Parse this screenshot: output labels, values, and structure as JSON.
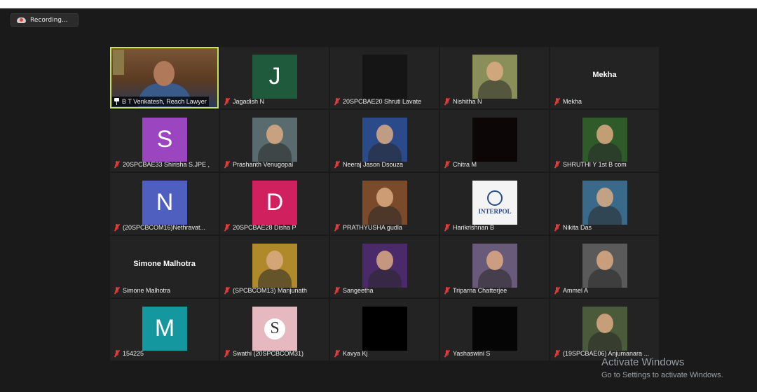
{
  "recording": {
    "label": "Recording..."
  },
  "participants": [
    {
      "name": "B T Venkatesh, Reach Lawyer",
      "type": "video",
      "pinned": true,
      "active": true,
      "bg": "#6b4a2e"
    },
    {
      "name": "Jagadish N",
      "type": "letter",
      "letter": "J",
      "bg": "#1f5a3d"
    },
    {
      "name": "20SPCBAE20 Shruti Lavate",
      "type": "photo",
      "bg": "#151515"
    },
    {
      "name": "Nishitha N",
      "type": "photo",
      "bg": "#8a8f5a"
    },
    {
      "name": "Mekha",
      "type": "text",
      "display": "Mekha"
    },
    {
      "name": "20SPCBAE33 Shirisha S.JPE ,",
      "type": "letter",
      "letter": "S",
      "bg": "#9b45c0"
    },
    {
      "name": "Prashanth Venugopal",
      "type": "photo",
      "bg": "#5a6b70"
    },
    {
      "name": "Neeraj Jason  Dsouza",
      "type": "photo",
      "bg": "#2a4a8a"
    },
    {
      "name": "Chitra M",
      "type": "photo",
      "bg": "#0d0606"
    },
    {
      "name": "SHRUTHI Y 1st B com",
      "type": "photo",
      "bg": "#2f5a2a"
    },
    {
      "name": "(20SPCBCOM16)Nethravat...",
      "type": "letter",
      "letter": "N",
      "bg": "#4f5fc0"
    },
    {
      "name": "20SPCBAE28 Disha P",
      "type": "letter",
      "letter": "D",
      "bg": "#d0215e"
    },
    {
      "name": "PRATHYUSHA gudla",
      "type": "photo",
      "bg": "#7a4a2a"
    },
    {
      "name": "Harikrishnan B",
      "type": "photo",
      "bg": "#f4f4f4"
    },
    {
      "name": "Nikita Das",
      "type": "photo",
      "bg": "#3a6a8a"
    },
    {
      "name": "Simone Malhotra",
      "type": "text",
      "display": "Simone Malhotra"
    },
    {
      "name": "(SPCBCOM13) Manjunath",
      "type": "photo",
      "bg": "#b08a2a"
    },
    {
      "name": "Sangeetha",
      "type": "photo",
      "bg": "#4a2a6a"
    },
    {
      "name": "Triparna Chatterjee",
      "type": "photo",
      "bg": "#6a5a7a"
    },
    {
      "name": "Ammel A",
      "type": "photo",
      "bg": "#5a5a5a"
    },
    {
      "name": "154225",
      "type": "letter",
      "letter": "M",
      "bg": "#1597a0"
    },
    {
      "name": "Swathi (20SPCBCOM31)",
      "type": "photo",
      "bg": "#e6b8c0",
      "letter": "S"
    },
    {
      "name": "Kavya Kj",
      "type": "photo",
      "bg": "#000000"
    },
    {
      "name": "Yashaswini S",
      "type": "photo",
      "bg": "#050505"
    },
    {
      "name": "(19SPCBAE06) Anjumanara ...",
      "type": "photo",
      "bg": "#4a5a3a"
    }
  ],
  "interpol_label": "INTERPOL",
  "watermark": {
    "title": "Activate Windows",
    "subtitle": "Go to Settings to activate Windows."
  }
}
